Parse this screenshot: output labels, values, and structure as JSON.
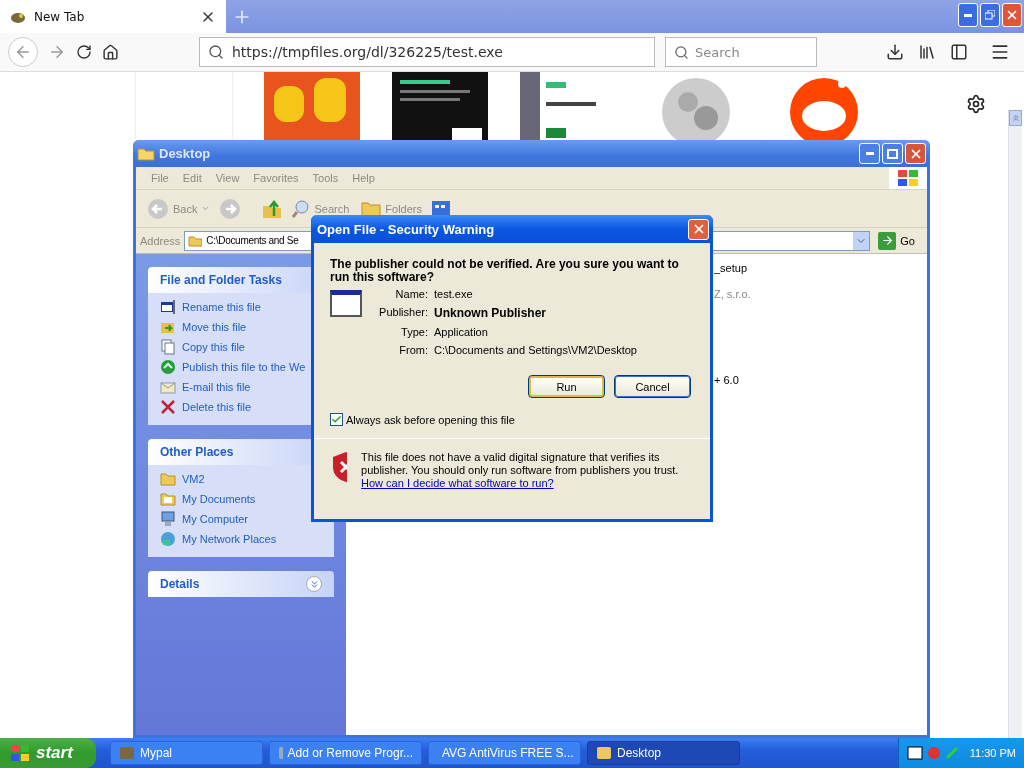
{
  "browser": {
    "tab": {
      "title": "New Tab"
    },
    "url": "https://tmpfiles.org/dl/326225/test.exe",
    "search": {
      "placeholder": "Search"
    },
    "top_sites": [
      {
        "kind": "blank"
      },
      {
        "kind": "picture"
      },
      {
        "kind": "picture"
      },
      {
        "kind": "picture"
      },
      {
        "kind": "picture"
      },
      {
        "kind": "picture"
      }
    ]
  },
  "explorer": {
    "title": "Desktop",
    "menu": [
      "File",
      "Edit",
      "View",
      "Favorites",
      "Tools",
      "Help"
    ],
    "toolbar": [
      {
        "label": "Back",
        "kind": "back"
      },
      {
        "label": "Search",
        "kind": "search"
      },
      {
        "label": "Folders",
        "kind": "folders"
      }
    ],
    "address": {
      "label": "Address",
      "value": "C:\\Documents and Se",
      "go": "Go"
    },
    "sections": [
      {
        "title": "File and Folder Tasks",
        "expanded": true,
        "items": [
          "Rename this file",
          "Move this file",
          "Copy this file",
          "Publish this file to the We",
          "E-mail this file",
          "Delete this file"
        ]
      },
      {
        "title": "Other Places",
        "expanded": true,
        "items": [
          "VM2",
          "My Documents",
          "My Computer",
          "My Network Places"
        ]
      },
      {
        "title": "Details",
        "expanded": false
      }
    ],
    "fragments": [
      {
        "text": "_setup",
        "kind": "name"
      },
      {
        "text": "Z, s.r.o.",
        "kind": "detail"
      },
      {
        "text": "+ 6.0",
        "kind": "name"
      }
    ]
  },
  "dialog": {
    "title": "Open File - Security Warning",
    "heading": "The publisher could not be verified.  Are you sure you want to run this software?",
    "fields": [
      {
        "label": "Name:",
        "value": "test.exe",
        "bold": false
      },
      {
        "label": "Publisher:",
        "value": "Unknown Publisher",
        "bold": true
      },
      {
        "label": "Type:",
        "value": "Application",
        "bold": false
      },
      {
        "label": "From:",
        "value": "C:\\Documents and Settings\\VM2\\Desktop",
        "bold": false
      }
    ],
    "buttons": [
      {
        "label": "Run",
        "default": true
      },
      {
        "label": "Cancel",
        "default": false
      }
    ],
    "checkbox": {
      "label": "Always ask before opening this file",
      "checked": true
    },
    "warning": "This file does not have a valid digital signature that verifies its publisher.  You should only run software from publishers you trust.",
    "link": "How can I decide what software to run?"
  },
  "taskbar": {
    "start": "start",
    "tasks": [
      {
        "label": "Mypal",
        "selected": false
      },
      {
        "label": "Add or Remove Progr...",
        "selected": false
      },
      {
        "label": "AVG AntiVirus FREE S...",
        "selected": false
      },
      {
        "label": "Desktop",
        "selected": true
      }
    ],
    "clock": "11:30 PM"
  }
}
